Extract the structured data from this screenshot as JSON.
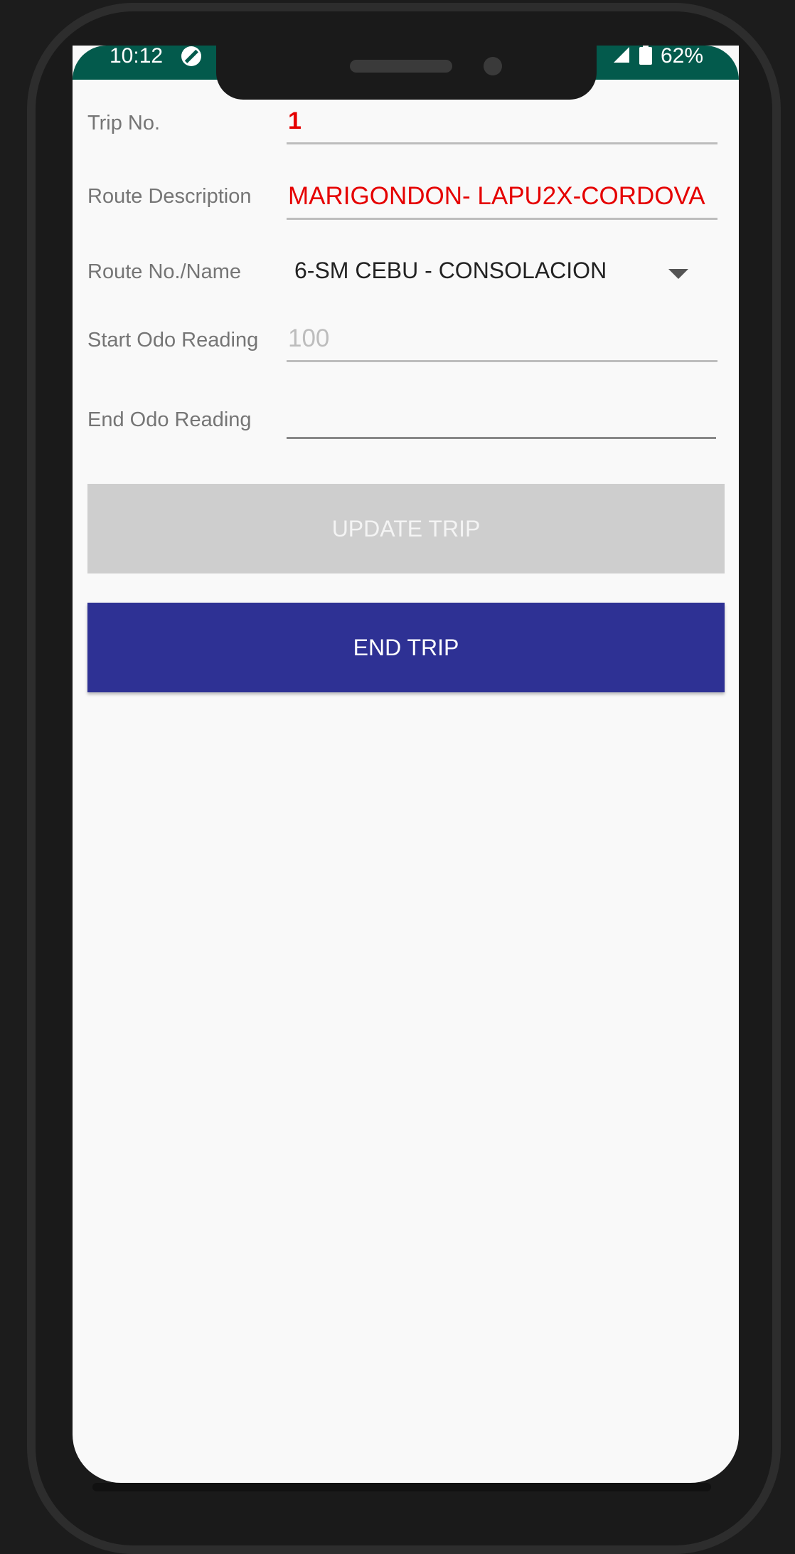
{
  "status_bar": {
    "time": "10:12",
    "battery": "62%",
    "icons": [
      "dnd-icon",
      "signal-icon",
      "battery-icon"
    ],
    "background": "#035a4c"
  },
  "form": {
    "trip_no": {
      "label": "Trip No.",
      "value": "1"
    },
    "route_description": {
      "label": "Route Description",
      "value": "MARIGONDON- LAPU2X-CORDOVA"
    },
    "route_no_name": {
      "label": "Route No./Name",
      "selected": "6-SM CEBU - CONSOLACION"
    },
    "start_odo": {
      "label": "Start Odo Reading",
      "placeholder": "100"
    },
    "end_odo": {
      "label": "End Odo Reading",
      "value": ""
    }
  },
  "buttons": {
    "update_trip": "UPDATE TRIP",
    "end_trip": "END TRIP"
  },
  "colors": {
    "accent_red": "#e50000",
    "end_trip_bg": "#2e3194",
    "update_trip_bg": "#cecece"
  }
}
